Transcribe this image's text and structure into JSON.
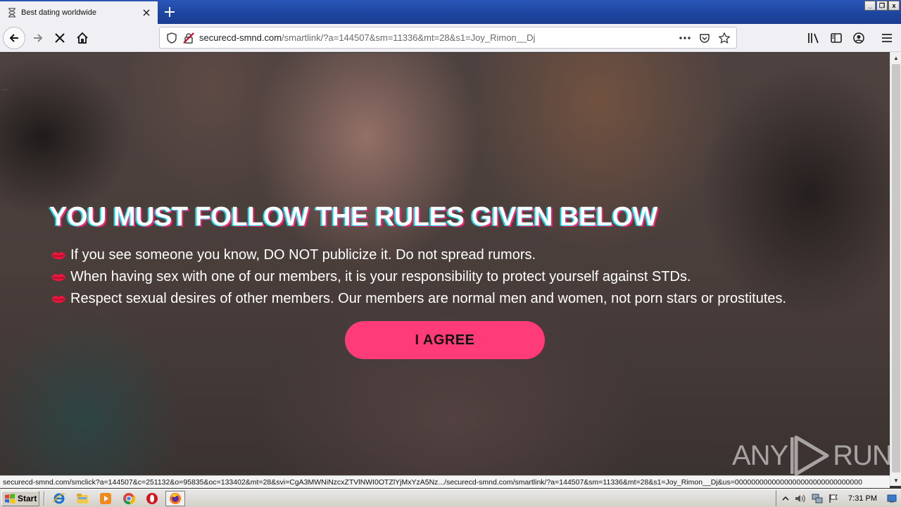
{
  "browser": {
    "tab": {
      "title": "Best dating worldwide",
      "icon": "hourglass-icon"
    },
    "url": {
      "host": "securecd-smnd.com",
      "path": "/smartlink/?a=144507&sm=11336&mt=28&s1=Joy_Rimon__Dj"
    },
    "window_controls": [
      "_",
      "❐",
      "x"
    ]
  },
  "page": {
    "dots": "...",
    "headline": "YOU MUST FOLLOW THE RULES GIVEN BELOW",
    "rules": [
      "If you see someone you know, DO NOT publicize it. Do not spread rumors.",
      "When having sex with one of our members, it is your responsibility to protect yourself against STDs.",
      "Respect sexual desires of other members. Our members are normal men and women, not porn stars or prostitutes."
    ],
    "agree_label": "I AGREE",
    "watermark": {
      "left": "ANY",
      "right": "RUN"
    },
    "accent_color": "#ff3b78"
  },
  "status_bar": {
    "text": "securecd-smnd.com/smclick?a=144507&c=251132&o=95835&oc=133402&mt=28&svi=CgA3MWNiNzcxZTVlNWI0OTZlYjMxYzA5Nz.../securecd-smnd.com/smartlink/?a=144507&sm=11336&mt=28&s1=Joy_Rimon__Dj&us=0000000000000000000000000000000"
  },
  "taskbar": {
    "start_label": "Start",
    "apps": [
      "ie-icon",
      "explorer-icon",
      "media-player-icon",
      "chrome-icon",
      "opera-icon",
      "firefox-icon"
    ],
    "clock": "7:31 PM"
  }
}
